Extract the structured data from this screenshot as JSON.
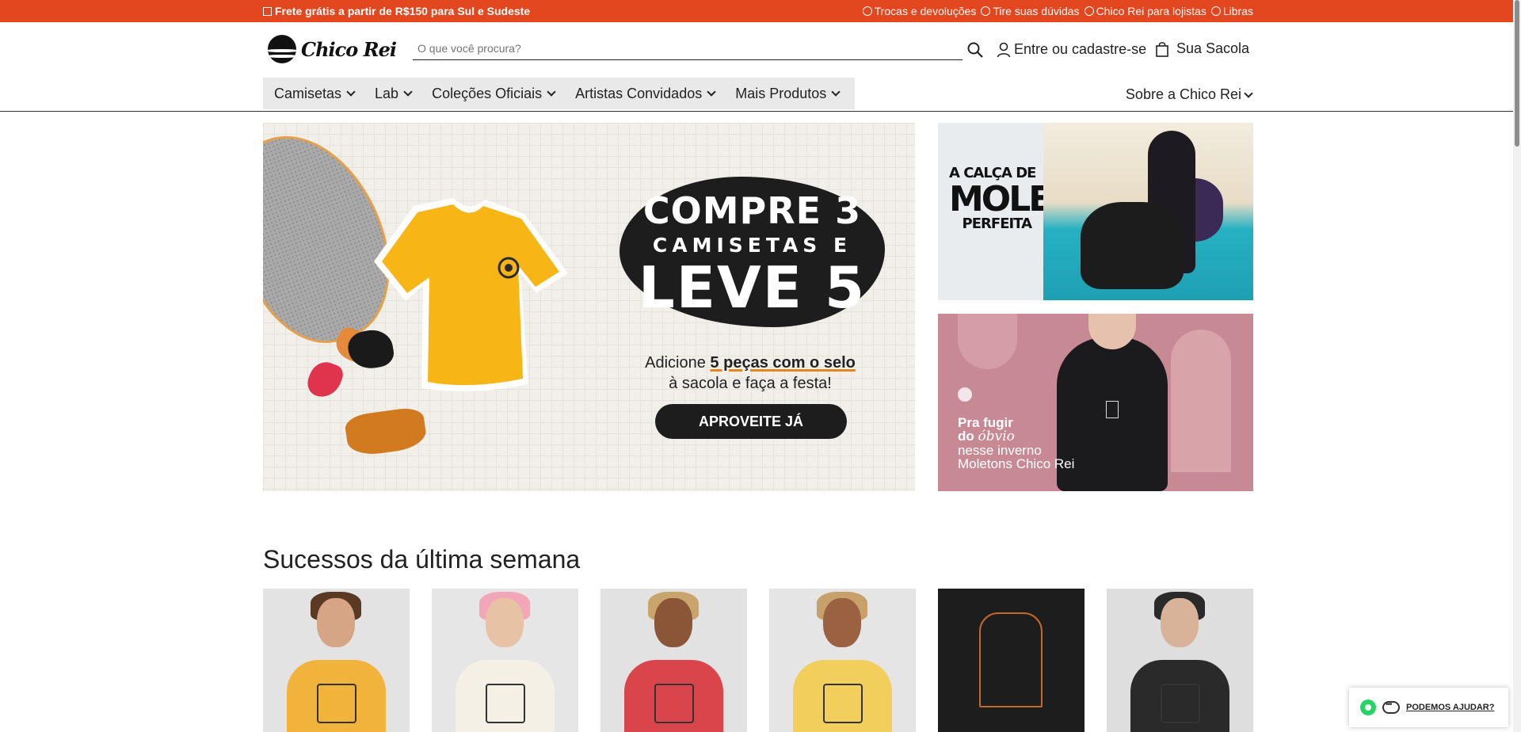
{
  "topbar": {
    "shipping": "Frete grátis a partir de R$150 para Sul e Sudeste",
    "links": [
      "Trocas e devoluções",
      "Tire suas dúvidas",
      "Chico Rei para lojistas",
      "Libras"
    ],
    "color": "#e2471f"
  },
  "header": {
    "logo_text": "Chico Rei",
    "search_placeholder": "O que você procura?",
    "account_label": "Entre ou cadastre-se",
    "bag_label": "Sua Sacola"
  },
  "nav": {
    "items": [
      "Camisetas",
      "Lab",
      "Coleções Oficiais",
      "Artistas Convidados",
      "Mais Produtos"
    ],
    "about": "Sobre a Chico Rei"
  },
  "hero": {
    "line1": "COMPRE 3",
    "line2": "CAMISETAS E",
    "line3": "LEVE 5",
    "desc_prefix": "Adicione ",
    "desc_bold": "5 peças com o selo",
    "desc_suffix": "à sacola e faça a festa!",
    "cta": "APROVEITE JÁ"
  },
  "banner1": {
    "t1": "A CALÇA DE",
    "t2": "MOLETOM",
    "t3": "PERFEITA"
  },
  "banner2": {
    "a": "Pra fugir",
    "b_prefix": "do ",
    "b_italic": "óbvio",
    "c1": "nesse inverno",
    "c2": "Moletons Chico Rei"
  },
  "section": {
    "title": "Sucessos da última semana"
  },
  "products": [
    {
      "shirt": "#f2b33d",
      "bg": "#e3e3e3",
      "skin": "#d6a586",
      "hair": "#5a3a22"
    },
    {
      "shirt": "#f4f0e6",
      "bg": "#e6e6e6",
      "skin": "#e8c2a5",
      "hair": "#f2a7b8"
    },
    {
      "shirt": "#d9454b",
      "bg": "#e2e2e2",
      "skin": "#8a5637",
      "hair": "#c9a56b"
    },
    {
      "shirt": "#f2cf5d",
      "bg": "#e5e5e5",
      "skin": "#9a6241",
      "hair": "#c7a06a"
    },
    {
      "shirt": "#1d1d1d",
      "bg": "#1d1d1d",
      "skin": "#1d1d1d",
      "hair": "#1d1d1d"
    },
    {
      "shirt": "#2a2a2a",
      "bg": "#dedede",
      "skin": "#d8b39a",
      "hair": "#2a2a2a"
    }
  ],
  "chat": {
    "label": "PODEMOS AJUDAR?"
  }
}
